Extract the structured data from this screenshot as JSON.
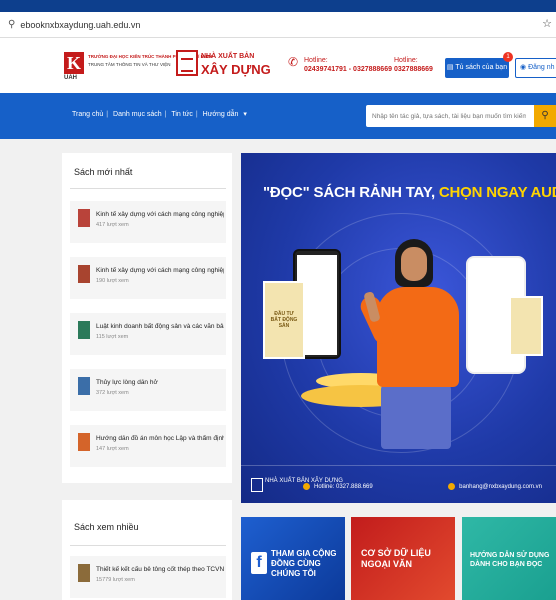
{
  "browser": {
    "url": "ebooknxbxaydung.uah.edu.vn"
  },
  "header": {
    "uah_line1": "TRƯỜNG ĐẠI HỌC KIẾN TRÚC THÀNH PHỐ HỒ CHÍ MINH",
    "uah_line2": "TRUNG TÂM THÔNG TIN VÀ THƯ VIỆN",
    "uah_short": "UAH",
    "publisher_top": "NHÀ XUẤT BẢN",
    "publisher_name": "XÂY DỰNG",
    "hotline1_label": "Hotline:",
    "hotline1_value": "02439741791 - 0327888669",
    "hotline2_label": "Hotline:",
    "hotline2_value": "0327888669",
    "cart_label": "Tủ sách của bạn",
    "cart_count": "1",
    "login_label": "Đăng nh"
  },
  "nav": {
    "items": [
      "Trang chủ",
      "Danh mục sách",
      "Tin tức",
      "Hướng dẫn"
    ],
    "search_placeholder": "Nhập tên tác giả, tựa sách, tài liệu bạn muốn tìm kiếm..."
  },
  "newest": {
    "title": "Sách mới nhất",
    "books": [
      {
        "title": "Kinh tế xây dựng với cách mạng công nghiệp...",
        "views": "417 lượt xem"
      },
      {
        "title": "Kinh tế xây dựng với cách mạng công nghiệp...",
        "views": "190 lượt xem"
      },
      {
        "title": "Luật kinh doanh bất động sản và các văn bản...",
        "views": "115 lượt xem"
      },
      {
        "title": "Thủy lực lòng dẫn hở",
        "views": "372 lượt xem"
      },
      {
        "title": "Hướng dẫn đồ án môn học Lập và thẩm định...",
        "views": "147 lượt xem"
      }
    ]
  },
  "most_viewed": {
    "title": "Sách xem nhiều",
    "books": [
      {
        "title": "Thiết kế kết cấu bê tông cốt thép theo TCVN...",
        "views": "15779 lượt xem"
      }
    ]
  },
  "banner": {
    "headline_white": "\"ĐỌC\" SÁCH RẢNH TAY, ",
    "headline_yellow": "CHỌN NGAY AUDIO BOOK",
    "book_title": "ĐẦU TƯ BẤT ĐỘNG SẢN",
    "footer_logo": "NHÀ XUẤT BẢN XÂY DỰNG",
    "footer_hotline": "Hotline: 0327.888.669",
    "footer_email": "banhang@nxbxaydung.com.vn"
  },
  "tiles": [
    {
      "text": "THAM GIA CỘNG ĐỒNG CÙNG CHÚNG TÔI"
    },
    {
      "text": "CƠ SỞ DỮ LIỆU NGOẠI VĂN"
    },
    {
      "text": "HƯỚNG DẪN SỬ DỤNG DÀNH CHO BẠN ĐỌC"
    }
  ],
  "colors": {
    "nav_blue": "#1660c8",
    "brand_red": "#c41b1b",
    "search_yellow": "#f2a900"
  }
}
